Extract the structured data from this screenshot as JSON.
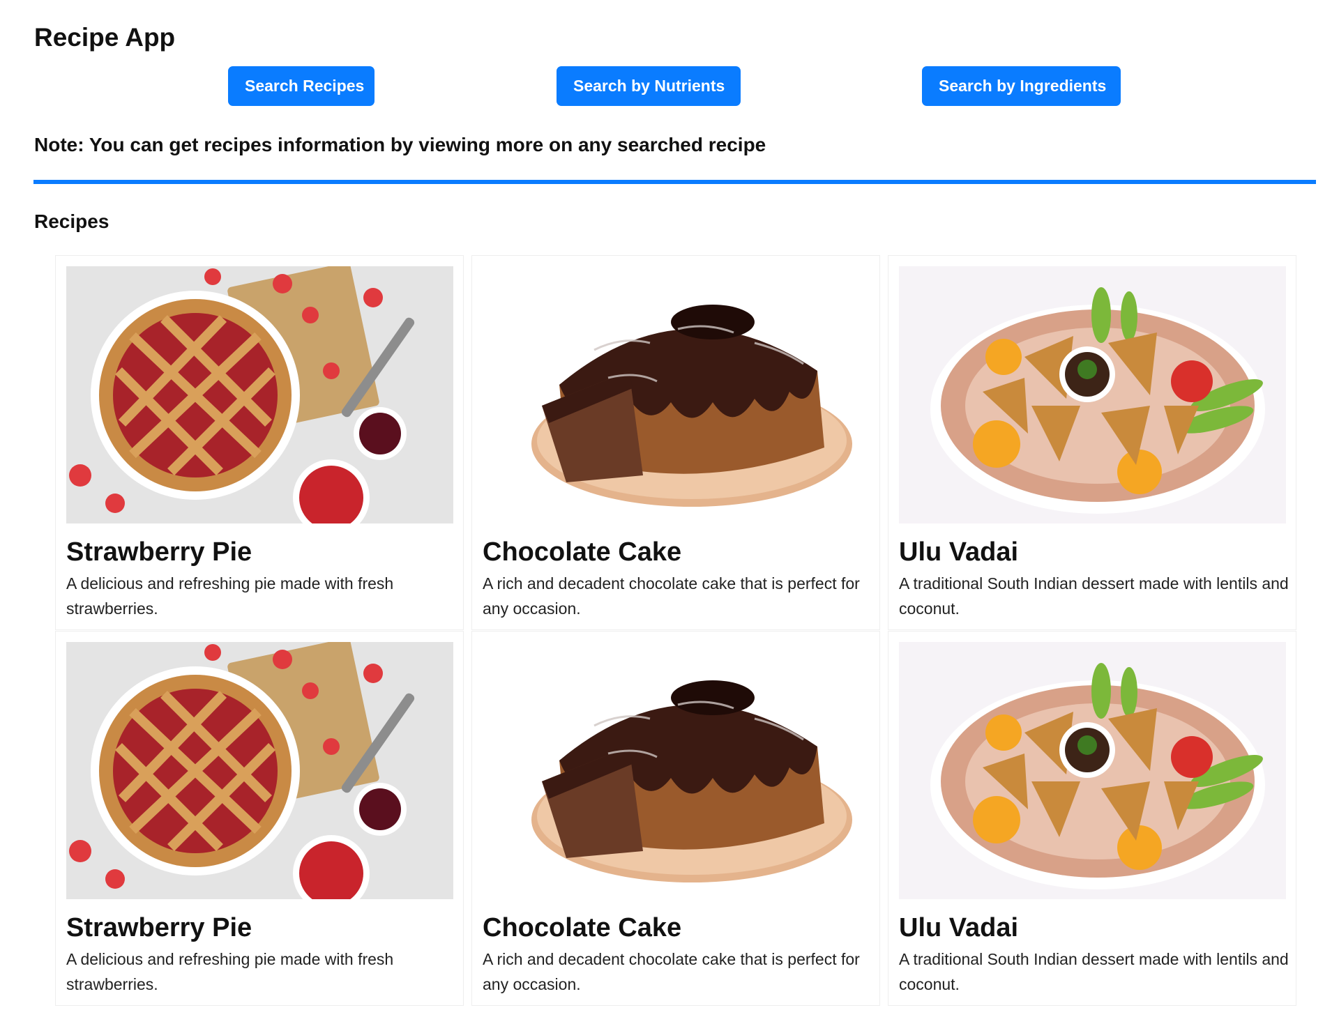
{
  "app": {
    "title": "Recipe App"
  },
  "nav": {
    "search_recipes": "Search Recipes",
    "search_nutrients": "Search by Nutrients",
    "search_ingredients": "Search by Ingredients"
  },
  "note": "Note: You can get recipes information by viewing more on any searched recipe",
  "section": {
    "title": "Recipes"
  },
  "recipes": [
    {
      "name": "Strawberry Pie",
      "description": "A delicious and refreshing pie made with fresh strawberries."
    },
    {
      "name": "Chocolate Cake",
      "description": "A rich and decadent chocolate cake that is perfect for any occasion."
    },
    {
      "name": "Ulu Vadai",
      "description": "A traditional South Indian dessert made with lentils and coconut."
    },
    {
      "name": "Strawberry Pie",
      "description": "A delicious and refreshing pie made with fresh strawberries."
    },
    {
      "name": "Chocolate Cake",
      "description": "A rich and decadent chocolate cake that is perfect for any occasion."
    },
    {
      "name": "Ulu Vadai",
      "description": "A traditional South Indian dessert made with lentils and coconut."
    }
  ],
  "colors": {
    "accent": "#0a7cff",
    "button_text": "#ffffff"
  }
}
